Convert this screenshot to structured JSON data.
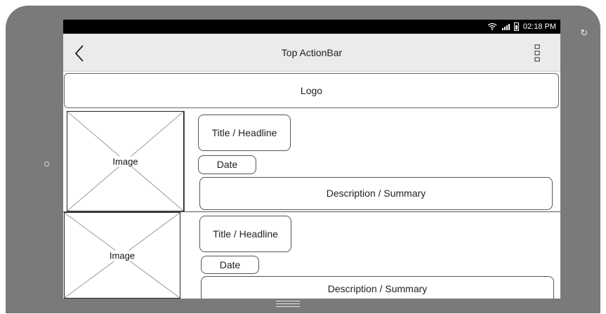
{
  "status_bar": {
    "time": "02:18 PM"
  },
  "action_bar": {
    "title": "Top ActionBar"
  },
  "logo": {
    "label": "Logo"
  },
  "items": [
    {
      "image_label": "Image",
      "title": "Title / Headline",
      "date": "Date",
      "description": "Description / Summary"
    },
    {
      "image_label": "Image",
      "title": "Title / Headline",
      "date": "Date",
      "description": "Description / Summary"
    }
  ],
  "icons": {
    "back": "chevron-left-icon",
    "overflow": "vertical-dots-icon",
    "rotate": "rotate-icon",
    "wifi": "wifi-icon",
    "signal": "signal-icon",
    "battery": "battery-icon",
    "nav": "nav-handle-icon"
  }
}
